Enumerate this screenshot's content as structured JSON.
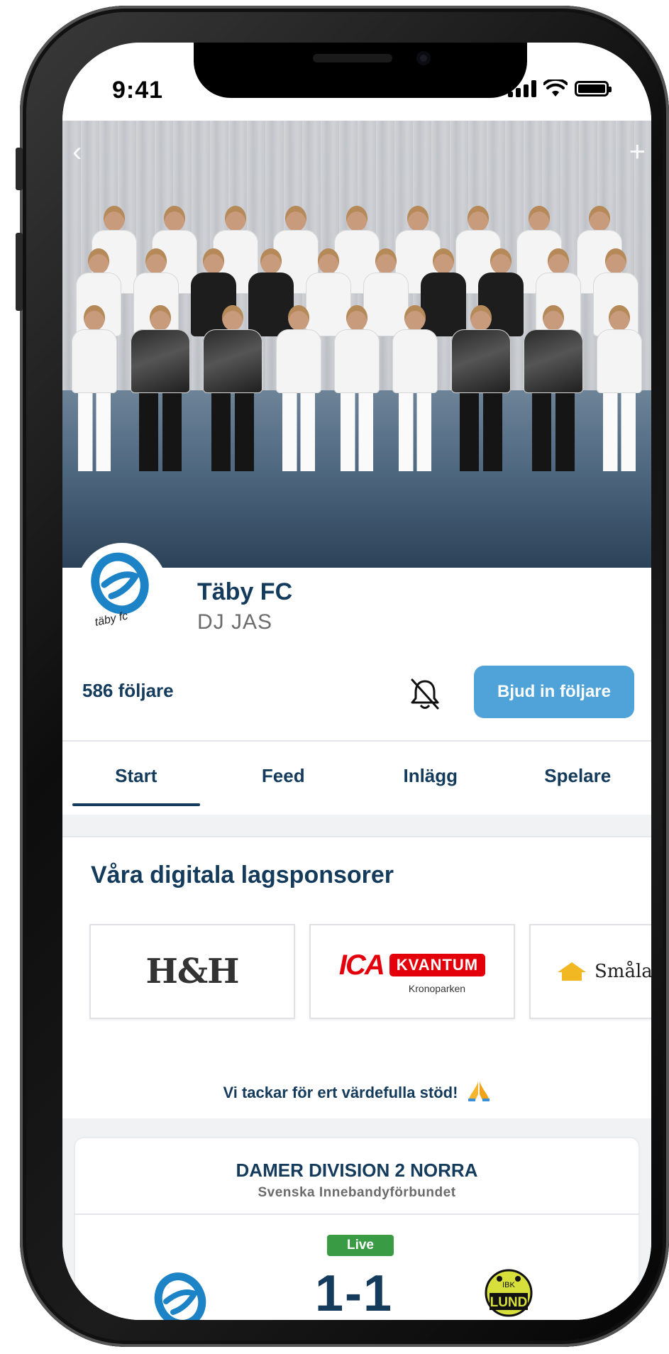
{
  "status_bar": {
    "time": "9:41"
  },
  "club": {
    "name": "Täby FC",
    "team": "DJ JAS",
    "followers": "586 följare",
    "logo_text": "täby fc"
  },
  "actions": {
    "invite_label": "Bjud in följare"
  },
  "tabs": [
    {
      "label": "Start",
      "active": true
    },
    {
      "label": "Feed",
      "active": false
    },
    {
      "label": "Inlägg",
      "active": false
    },
    {
      "label": "Spelare",
      "active": false
    }
  ],
  "sponsors": {
    "heading": "Våra digitala lagsponsorer",
    "items": [
      {
        "name": "H&H"
      },
      {
        "name": "ICA",
        "badge": "KVANTUM",
        "sub": "Kronoparken"
      },
      {
        "name": "Småla"
      }
    ],
    "thanks": "Vi tackar för ert värdefulla stöd!"
  },
  "match": {
    "league": "DAMER DIVISION 2 NORRA",
    "organizer": "Svenska Innebandyförbundet",
    "status": "Live",
    "score": "1-1",
    "away_logo_text": {
      "top": "IBK",
      "bottom": "LUND"
    }
  },
  "colors": {
    "brand_navy": "#143a5c",
    "accent_blue": "#4fa3d8",
    "live_green": "#3a9b45",
    "ica_red": "#e3000b"
  }
}
